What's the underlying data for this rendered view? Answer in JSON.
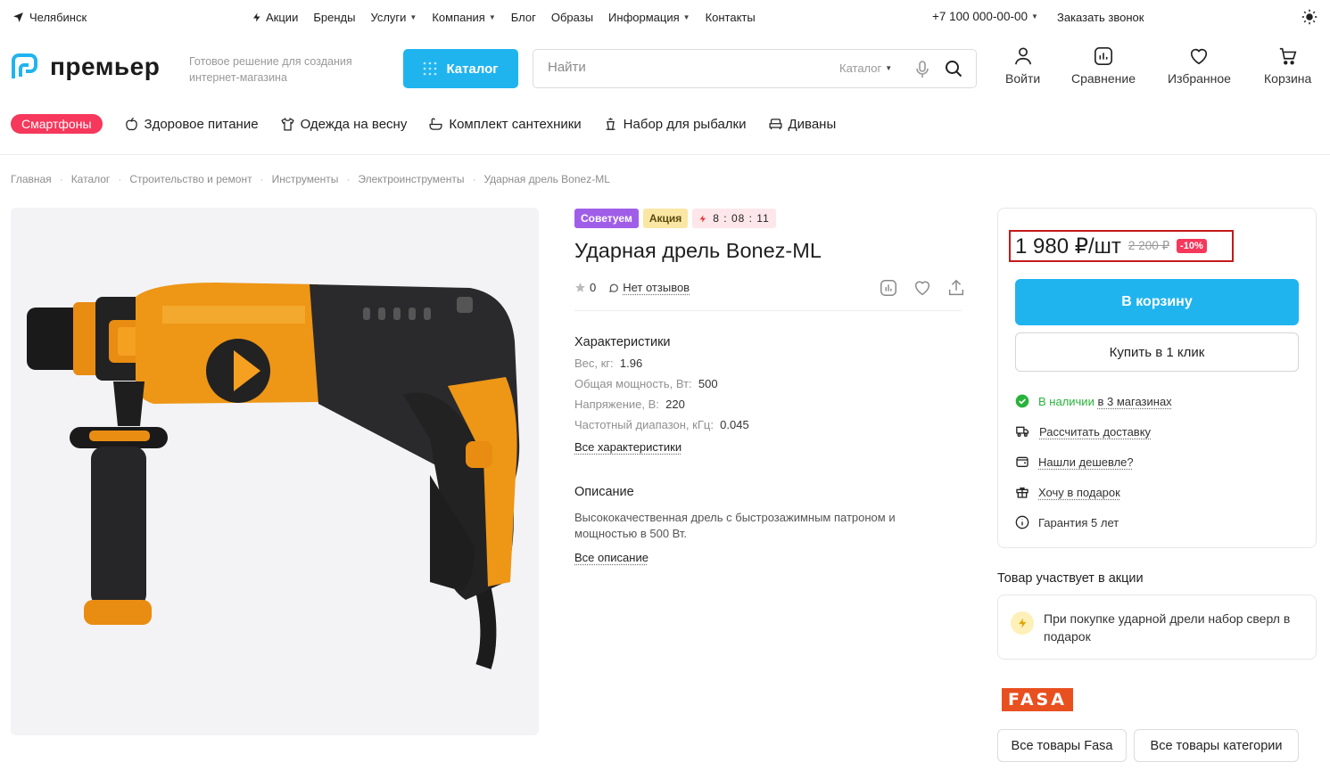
{
  "topbar": {
    "city": "Челябинск",
    "nav": [
      {
        "label": "Акции",
        "icon": "lightning-icon"
      },
      {
        "label": "Бренды"
      },
      {
        "label": "Услуги",
        "dropdown": true
      },
      {
        "label": "Компания",
        "dropdown": true
      },
      {
        "label": "Блог"
      },
      {
        "label": "Образы"
      },
      {
        "label": "Информация",
        "dropdown": true
      },
      {
        "label": "Контакты"
      }
    ],
    "phone": "+7 100 000-00-00",
    "callback": "Заказать звонок"
  },
  "header": {
    "logo_text": "премьер",
    "tagline": "Готовое решение для создания интернет-магазина",
    "catalog_button": "Каталог",
    "search": {
      "placeholder": "Найти",
      "scope": "Каталог"
    },
    "actions": {
      "login": "Войти",
      "compare": "Сравнение",
      "favorites": "Избранное",
      "cart": "Корзина"
    }
  },
  "categories": {
    "highlight": "Смартфоны",
    "items": [
      "Здоровое питание",
      "Одежда на весну",
      "Комплект сантехники",
      "Набор для рыбалки",
      "Диваны"
    ]
  },
  "breadcrumbs": [
    "Главная",
    "Каталог",
    "Строительство и ремонт",
    "Инструменты",
    "Электроинструменты",
    "Ударная дрель Bonez-ML"
  ],
  "product": {
    "badges": {
      "recommend": "Советуем",
      "sale": "Акция",
      "timer": "8 : 08 : 11"
    },
    "title": "Ударная дрель Bonez-ML",
    "rating": "0",
    "reviews": "Нет отзывов",
    "chars_title": "Характеристики",
    "chars": [
      {
        "k": "Вес, кг:",
        "v": "1.96"
      },
      {
        "k": "Общая мощность, Вт:",
        "v": "500"
      },
      {
        "k": "Напряжение, В:",
        "v": "220"
      },
      {
        "k": "Частотный диапазон, кГц:",
        "v": "0.045"
      }
    ],
    "all_chars": "Все характеристики",
    "desc_title": "Описание",
    "desc": "Высококачественная дрель с быстрозажимным патроном и мощностью в 500 Вт.",
    "all_desc": "Все описание"
  },
  "buy": {
    "price": "1 980 ₽/шт",
    "old_price": "2 200 ₽",
    "discount": "-10%",
    "cart_button": "В корзину",
    "oneclick_button": "Купить в 1 клик",
    "stock_status": "В наличии",
    "stock_where": "в 3 магазинах",
    "delivery": "Рассчитать доставку",
    "cheaper": "Нашли дешевле?",
    "gift": "Хочу в подарок",
    "warranty": "Гарантия 5 лет"
  },
  "promo": {
    "heading": "Товар участвует в акции",
    "text": "При покупке ударной дрели набор сверл в подарок"
  },
  "brand": {
    "logo": "FASA",
    "all_brand": "Все товары Fasa",
    "all_category": "Все товары категории"
  },
  "colors": {
    "accent": "#20b4ef",
    "sale": "#f5385b",
    "price_frame": "#c41a1a",
    "in_stock": "#27b33a"
  }
}
